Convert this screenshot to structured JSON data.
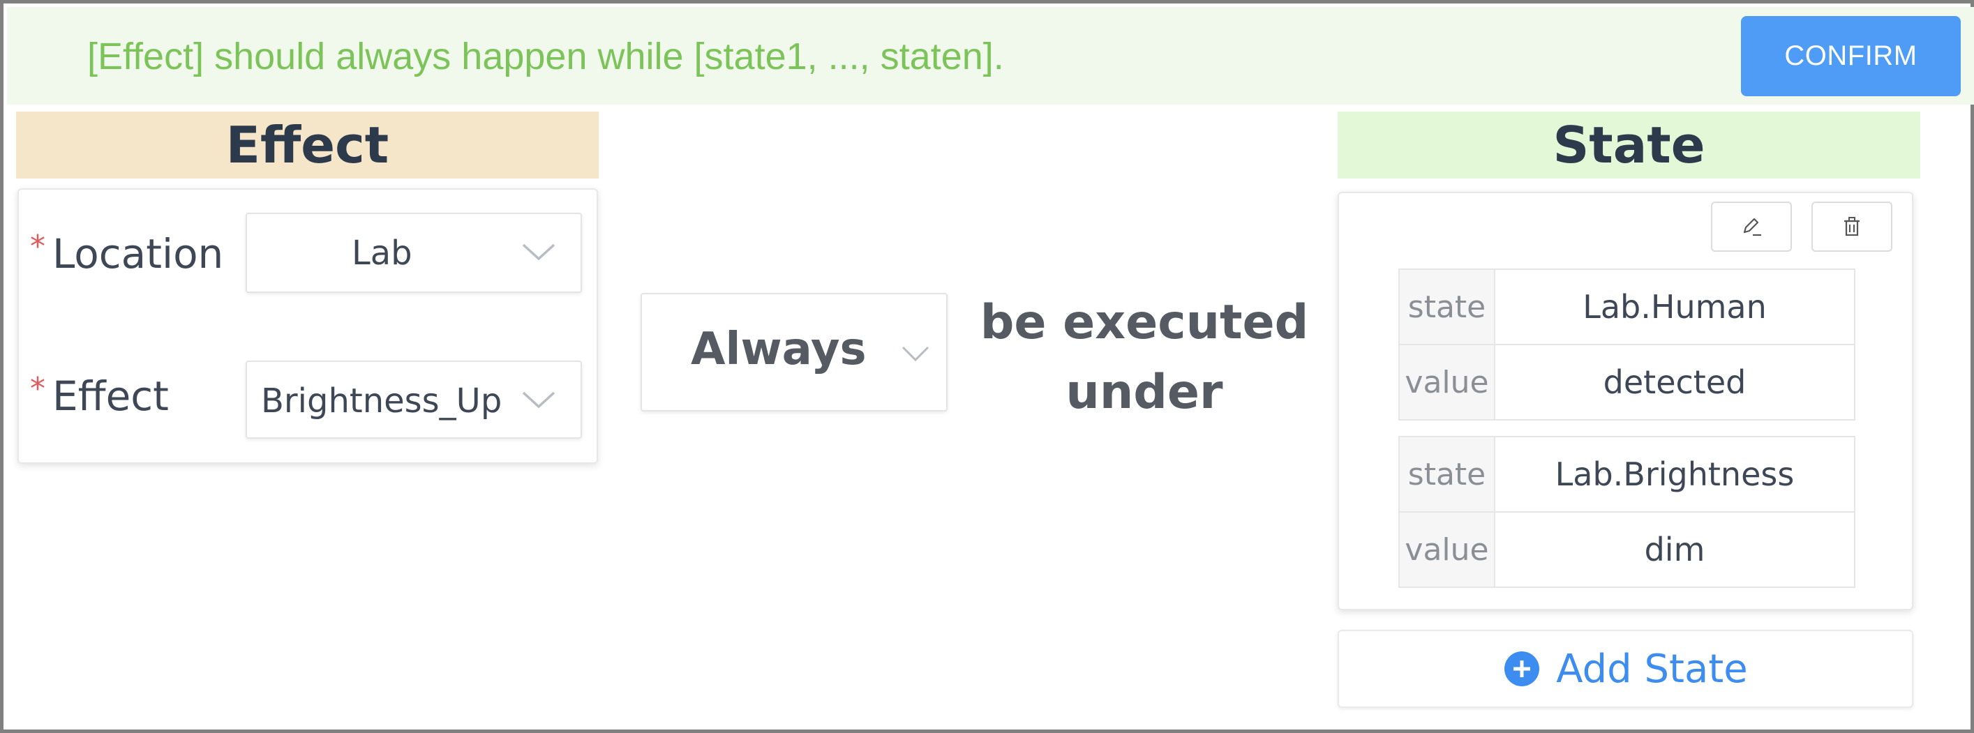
{
  "banner": {
    "template_text": "[Effect] should always happen while [state1, ..., staten].",
    "confirm_label": "CONFIRM"
  },
  "effect_section": {
    "header": "Effect",
    "location": {
      "label": "Location",
      "required_mark": "*",
      "value": "Lab"
    },
    "effect": {
      "label": "Effect",
      "required_mark": "*",
      "value": "Brightness_Up"
    }
  },
  "condition": {
    "mode_value": "Always",
    "connector_line1": "be executed",
    "connector_line2": "under"
  },
  "state_section": {
    "header": "State",
    "groups": [
      {
        "state_key": "state",
        "state_value": "Lab.Human",
        "value_key": "value",
        "value_value": "detected"
      },
      {
        "state_key": "state",
        "state_value": "Lab.Brightness",
        "value_key": "value",
        "value_value": "dim"
      }
    ],
    "add_label": "Add State"
  },
  "colors": {
    "banner_bg": "#f1f8ec",
    "banner_text": "#7cc45a",
    "primary": "#4e9cf5",
    "effect_header_bg": "#f5e6ca",
    "state_header_bg": "#e3f8d6",
    "required": "#e05b5b"
  },
  "icons": [
    "chevron-down-icon",
    "edit-icon",
    "delete-icon",
    "plus-circle-icon"
  ]
}
